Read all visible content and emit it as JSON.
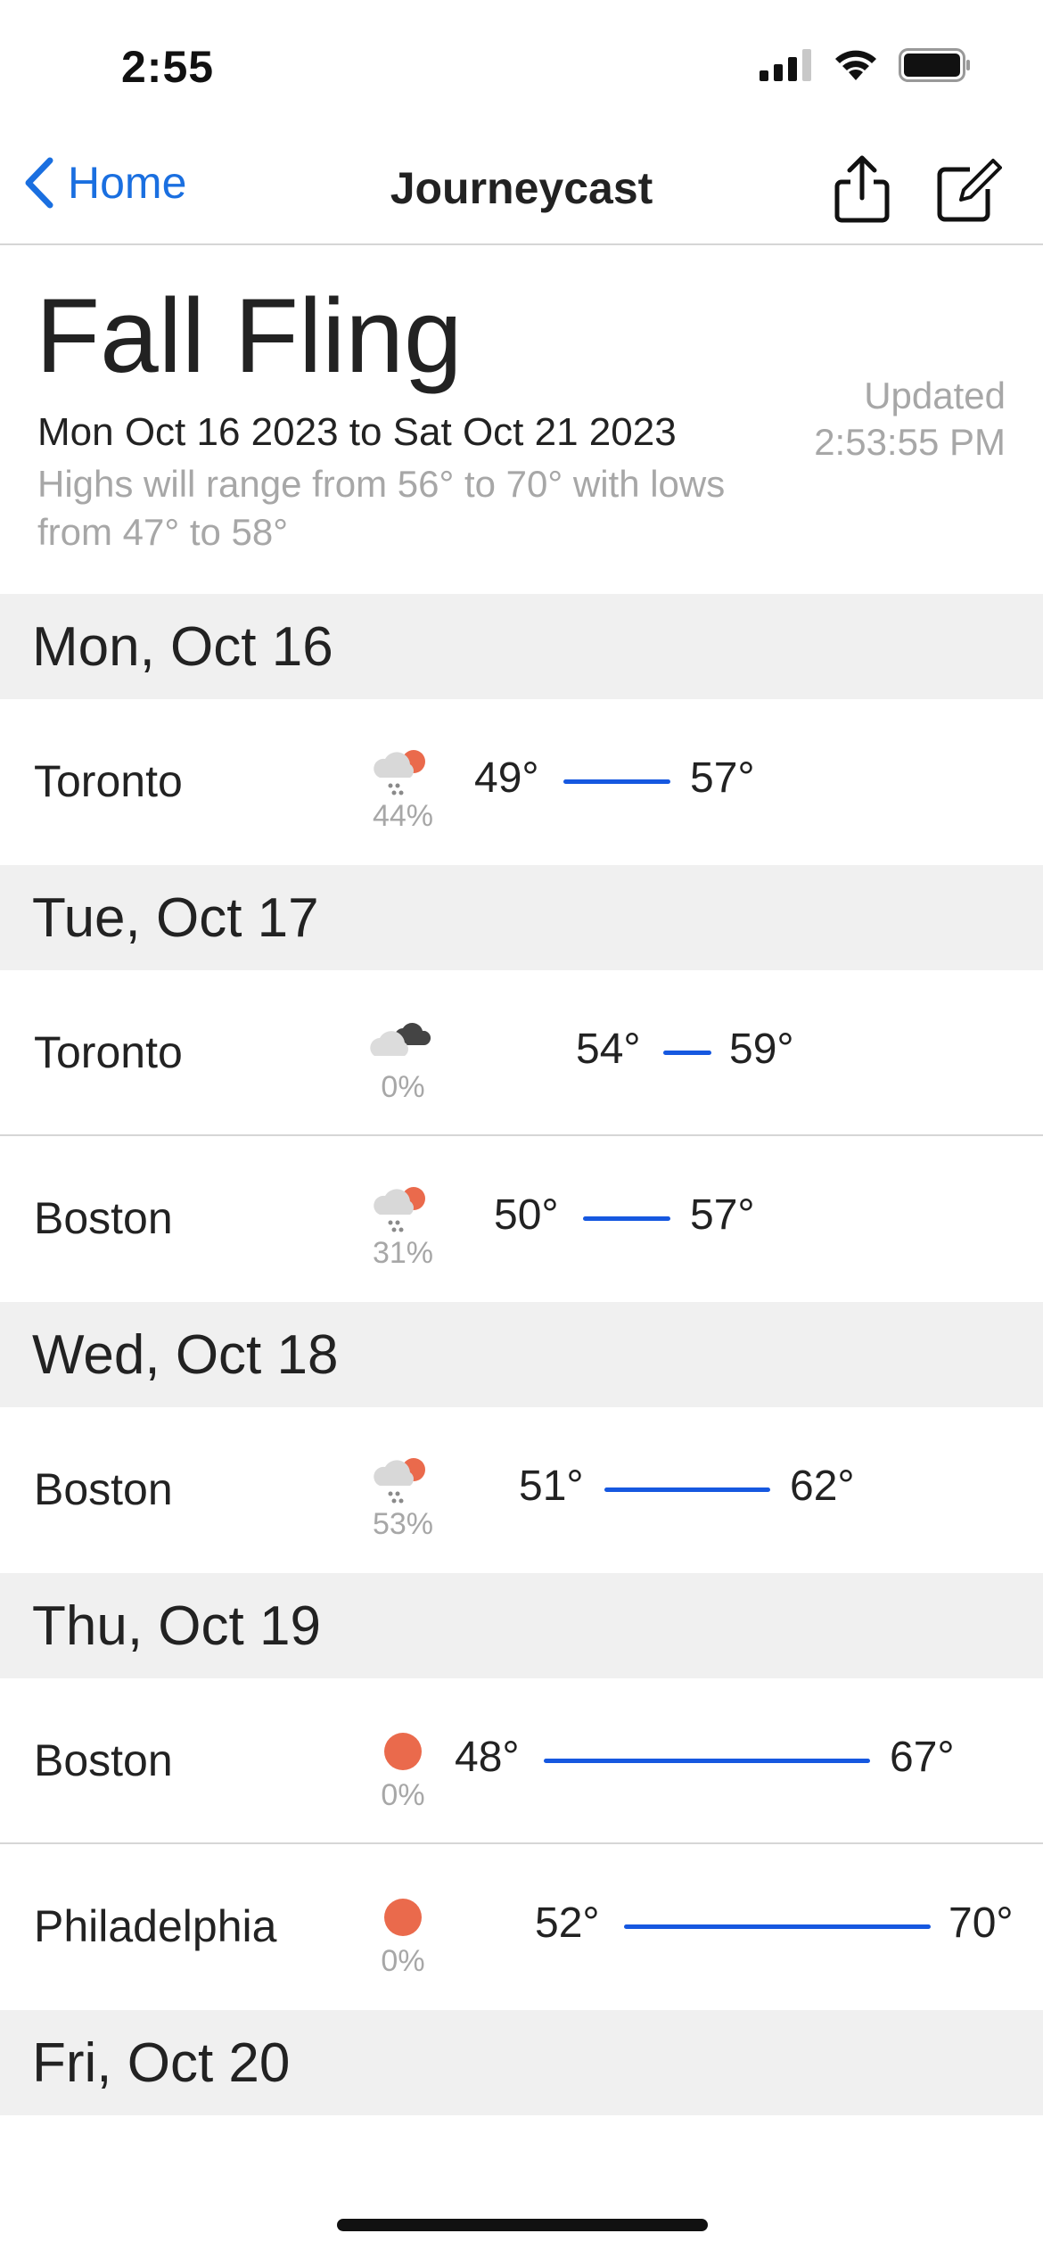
{
  "status_bar": {
    "time": "2:55",
    "icons": [
      "cellular-signal-icon",
      "wifi-icon",
      "battery-icon"
    ]
  },
  "nav": {
    "back_label": "Home",
    "title": "Journeycast",
    "icons": [
      "chevron-left-icon",
      "share-icon",
      "compose-icon"
    ]
  },
  "trip": {
    "title": "Fall Fling",
    "dates": "Mon Oct 16 2023 to Sat Oct 21 2023",
    "summary": "Highs will range from 56° to 70° with lows from 47° to 58°",
    "updated_label": "Updated",
    "updated_time": "2:53:55 PM"
  },
  "colors": {
    "accent": "#1a6fe0",
    "temp_bar": "#1658e0",
    "sun": "#ea6a4c",
    "muted": "#a7a7a7",
    "section_bg": "#f0f0f0"
  },
  "days": [
    {
      "label": "Mon, Oct 16",
      "rows": [
        {
          "city": "Toronto",
          "icon": "rain-sun-icon",
          "pop": "44%",
          "low": "49°",
          "high": "57°"
        }
      ]
    },
    {
      "label": "Tue, Oct 17",
      "rows": [
        {
          "city": "Toronto",
          "icon": "cloudy-icon",
          "pop": "0%",
          "low": "54°",
          "high": "59°"
        },
        {
          "city": "Boston",
          "icon": "rain-sun-icon",
          "pop": "31%",
          "low": "50°",
          "high": "57°"
        }
      ]
    },
    {
      "label": "Wed, Oct 18",
      "rows": [
        {
          "city": "Boston",
          "icon": "rain-sun-icon",
          "pop": "53%",
          "low": "51°",
          "high": "62°"
        }
      ]
    },
    {
      "label": "Thu, Oct 19",
      "rows": [
        {
          "city": "Boston",
          "icon": "sun-icon",
          "pop": "0%",
          "low": "48°",
          "high": "67°"
        },
        {
          "city": "Philadelphia",
          "icon": "sun-icon",
          "pop": "0%",
          "low": "52°",
          "high": "70°"
        }
      ]
    },
    {
      "label": "Fri, Oct 20",
      "rows": []
    }
  ]
}
